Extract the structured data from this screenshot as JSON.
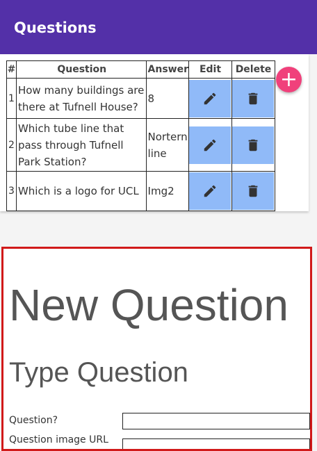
{
  "app": {
    "title": "Questions",
    "colors": {
      "app_bar": "#5330a8",
      "action_button": "#90baf8",
      "fab": "#f0407b",
      "highlight_border": "#d11a1a"
    }
  },
  "table": {
    "headers": [
      "#",
      "Question",
      "Answer",
      "Edit",
      "Delete"
    ],
    "rows": [
      {
        "num": "1",
        "question": "How many buildings are there at Tufnell House?",
        "answer": "8"
      },
      {
        "num": "2",
        "question": "Which tube line that pass through Tufnell Park Station?",
        "answer": "Nortern line"
      },
      {
        "num": "3",
        "question": "Which is a logo for UCL",
        "answer": "Img2"
      }
    ],
    "edit_icon": "pencil-icon",
    "delete_icon": "trash-icon"
  },
  "fab": {
    "label": "+",
    "icon": "plus-icon"
  },
  "form": {
    "heading": "New Question",
    "subheading": "Type Question",
    "fields": [
      {
        "label": "Question?",
        "value": "",
        "placeholder": ""
      },
      {
        "label": "Question image URL",
        "value": "",
        "placeholder": ""
      }
    ]
  }
}
